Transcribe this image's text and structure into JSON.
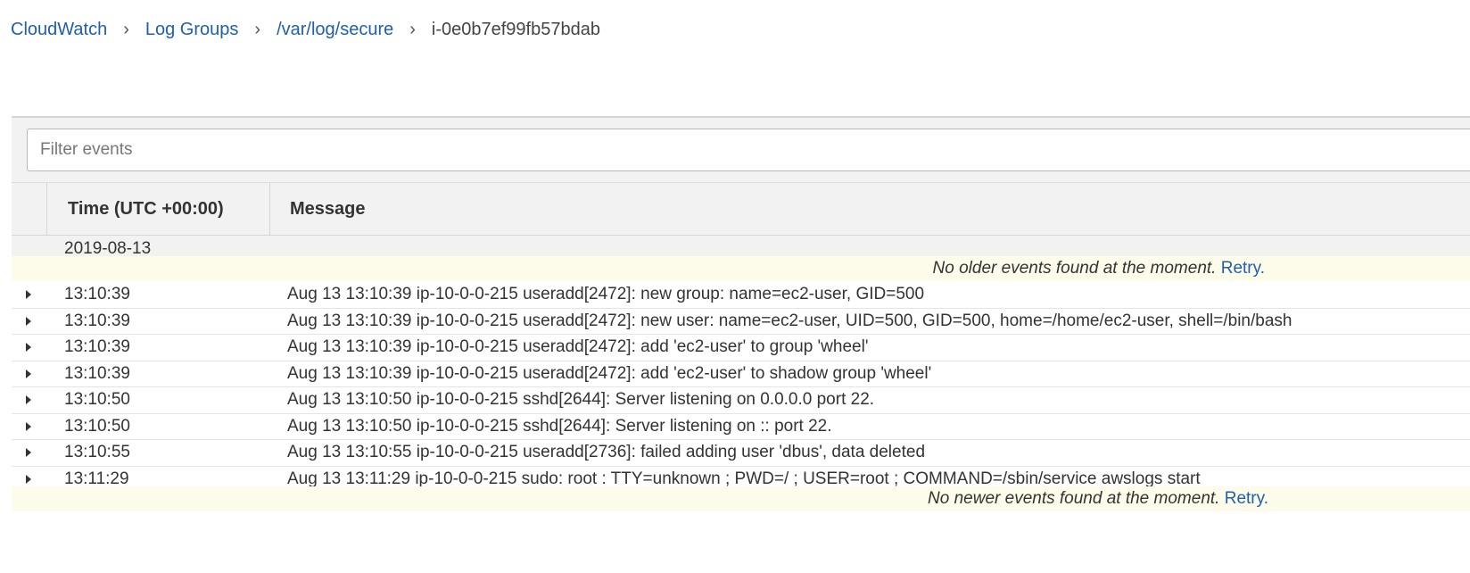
{
  "breadcrumb": {
    "items": [
      {
        "label": "CloudWatch"
      },
      {
        "label": "Log Groups"
      },
      {
        "label": "/var/log/secure"
      }
    ],
    "current": "i-0e0b7ef99fb57bdab"
  },
  "filter": {
    "placeholder": "Filter events",
    "value": ""
  },
  "table": {
    "columns": {
      "time": "Time (UTC +00:00)",
      "message": "Message"
    },
    "date_group": "2019-08-13",
    "older_notice": {
      "text": "No older events found at the moment.",
      "retry": "Retry."
    },
    "newer_notice": {
      "text": "No newer events found at the moment.",
      "retry": "Retry."
    },
    "rows": [
      {
        "time": "13:10:39",
        "message": "Aug 13 13:10:39 ip-10-0-0-215 useradd[2472]: new group: name=ec2-user, GID=500"
      },
      {
        "time": "13:10:39",
        "message": "Aug 13 13:10:39 ip-10-0-0-215 useradd[2472]: new user: name=ec2-user, UID=500, GID=500, home=/home/ec2-user, shell=/bin/bash"
      },
      {
        "time": "13:10:39",
        "message": "Aug 13 13:10:39 ip-10-0-0-215 useradd[2472]: add 'ec2-user' to group 'wheel'"
      },
      {
        "time": "13:10:39",
        "message": "Aug 13 13:10:39 ip-10-0-0-215 useradd[2472]: add 'ec2-user' to shadow group 'wheel'"
      },
      {
        "time": "13:10:50",
        "message": "Aug 13 13:10:50 ip-10-0-0-215 sshd[2644]: Server listening on 0.0.0.0 port 22."
      },
      {
        "time": "13:10:50",
        "message": "Aug 13 13:10:50 ip-10-0-0-215 sshd[2644]: Server listening on :: port 22."
      },
      {
        "time": "13:10:55",
        "message": "Aug 13 13:10:55 ip-10-0-0-215 useradd[2736]: failed adding user 'dbus', data deleted"
      },
      {
        "time": "13:11:29",
        "message": "Aug 13 13:11:29 ip-10-0-0-215 sudo: root : TTY=unknown ; PWD=/ ; USER=root ; COMMAND=/sbin/service awslogs start"
      }
    ]
  },
  "colors": {
    "link": "#1f5fae",
    "header_bg": "#f2f2f2",
    "notice_bg": "#fdfbea"
  },
  "icons": {
    "breadcrumb_separator": "chevron-right-icon",
    "row_expand": "caret-right-icon"
  }
}
